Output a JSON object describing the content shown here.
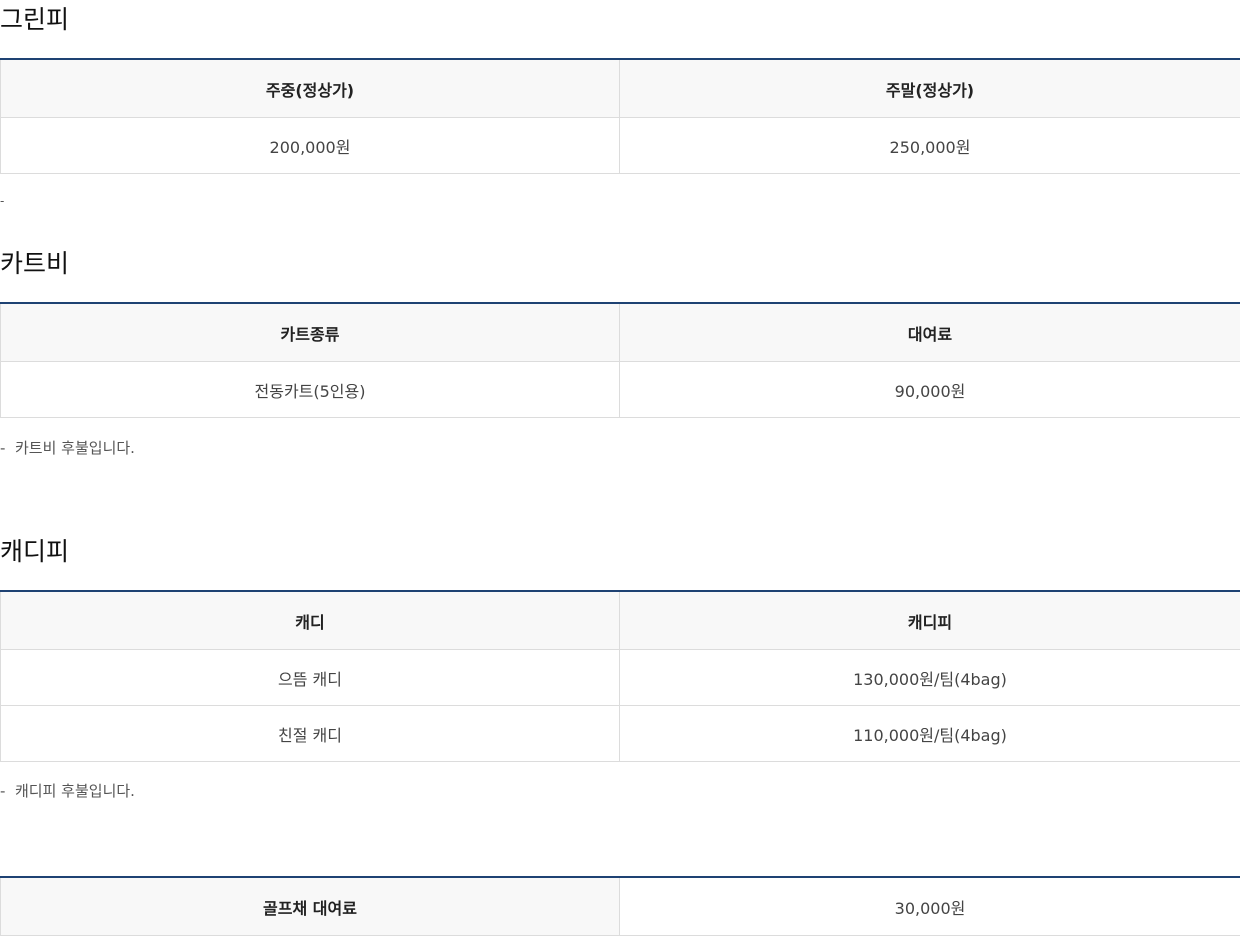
{
  "green_fee": {
    "title": "그린피",
    "headers": [
      "주중(정상가)",
      "주말(정상가)"
    ],
    "rows": [
      [
        "200,000원",
        "250,000원"
      ]
    ],
    "note_dash": "-"
  },
  "cart_fee": {
    "title": "카트비",
    "headers": [
      "카트종류",
      "대여료"
    ],
    "rows": [
      [
        "전동카트(5인용)",
        "90,000원"
      ]
    ],
    "note": "카트비 후불입니다.",
    "note_dash": "-"
  },
  "caddie_fee": {
    "title": "캐디피",
    "headers": [
      "캐디",
      "캐디피"
    ],
    "rows": [
      [
        "으뜸 캐디",
        "130,000원/팀(4bag)"
      ],
      [
        "친절 캐디",
        "110,000원/팀(4bag)"
      ]
    ],
    "note": "캐디피 후불입니다.",
    "note_dash": "-"
  },
  "club_rental": {
    "label": "골프채 대여료",
    "value": "30,000원"
  }
}
